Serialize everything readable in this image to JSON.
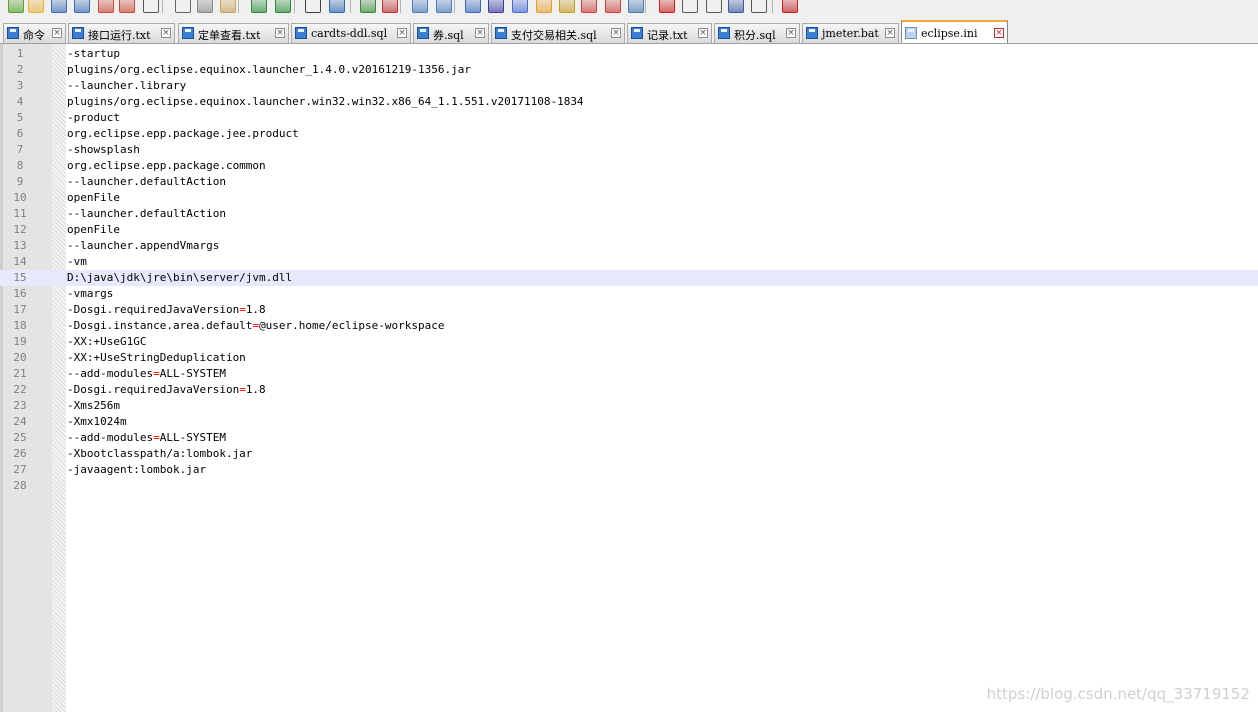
{
  "toolbar": {
    "icons": [
      "new-file-icon",
      "open-file-icon",
      "save-icon",
      "save-all-icon",
      "close-file-icon",
      "close-all-icon",
      "print-icon",
      "cut-icon",
      "copy-icon",
      "paste-icon",
      "undo-icon",
      "redo-icon",
      "find-icon",
      "replace-icon",
      "zoom-in-icon",
      "zoom-out-icon",
      "sync-vertical-icon",
      "sync-horizontal-icon",
      "word-wrap-icon",
      "show-all-chars-icon",
      "indent-guide-icon",
      "function-list-icon",
      "folder-workspace-icon",
      "document-map-icon",
      "clipboard-icon",
      "monitor-eye-icon",
      "record-macro-icon",
      "stop-record-icon",
      "play-macro-icon",
      "run-multiple-icon",
      "save-macro-icon",
      "spell-check-icon"
    ]
  },
  "tabs": [
    {
      "label": "命令",
      "active": false
    },
    {
      "label": "接口运行.txt",
      "active": false
    },
    {
      "label": "定单查看.txt",
      "active": false
    },
    {
      "label": "cardts-ddl.sql",
      "active": false
    },
    {
      "label": "券.sql",
      "active": false
    },
    {
      "label": "支付交易相关.sql",
      "active": false
    },
    {
      "label": "记录.txt",
      "active": false
    },
    {
      "label": "积分.sql",
      "active": false
    },
    {
      "label": "jmeter.bat",
      "active": false
    },
    {
      "label": "eclipse.ini",
      "active": true
    }
  ],
  "editor": {
    "current_line": 15,
    "lines": [
      {
        "n": "1",
        "text": "-startup"
      },
      {
        "n": "2",
        "text": "plugins/org.eclipse.equinox.launcher_1.4.0.v20161219-1356.jar"
      },
      {
        "n": "3",
        "text": "--launcher.library"
      },
      {
        "n": "4",
        "text": "plugins/org.eclipse.equinox.launcher.win32.win32.x86_64_1.1.551.v20171108-1834"
      },
      {
        "n": "5",
        "text": "-product"
      },
      {
        "n": "6",
        "text": "org.eclipse.epp.package.jee.product"
      },
      {
        "n": "7",
        "text": "-showsplash"
      },
      {
        "n": "8",
        "text": "org.eclipse.epp.package.common"
      },
      {
        "n": "9",
        "text": "--launcher.defaultAction"
      },
      {
        "n": "10",
        "text": "openFile"
      },
      {
        "n": "11",
        "text": "--launcher.defaultAction"
      },
      {
        "n": "12",
        "text": "openFile"
      },
      {
        "n": "13",
        "text": "--launcher.appendVmargs"
      },
      {
        "n": "14",
        "text": "-vm"
      },
      {
        "n": "15",
        "text": "D:\\java\\jdk\\jre\\bin\\server/jvm.dll"
      },
      {
        "n": "16",
        "text": "-vmargs"
      },
      {
        "n": "17",
        "text": "-Dosgi.requiredJavaVersion=1.8"
      },
      {
        "n": "18",
        "text": "-Dosgi.instance.area.default=@user.home/eclipse-workspace"
      },
      {
        "n": "19",
        "text": "-XX:+UseG1GC"
      },
      {
        "n": "20",
        "text": "-XX:+UseStringDeduplication"
      },
      {
        "n": "21",
        "text": "--add-modules=ALL-SYSTEM"
      },
      {
        "n": "22",
        "text": "-Dosgi.requiredJavaVersion=1.8"
      },
      {
        "n": "23",
        "text": "-Xms256m"
      },
      {
        "n": "24",
        "text": "-Xmx1024m"
      },
      {
        "n": "25",
        "text": "--add-modules=ALL-SYSTEM"
      },
      {
        "n": "26",
        "text": "-Xbootclasspath/a:lombok.jar"
      },
      {
        "n": "27",
        "text": "-javaagent:lombok.jar"
      },
      {
        "n": "28",
        "text": ""
      }
    ]
  },
  "watermark": "https://blog.csdn.net/qq_33719152",
  "colors": {
    "accent_tab": "#f9a53a",
    "current_line_bg": "#e8e8ff",
    "operator": "#ff0000"
  }
}
